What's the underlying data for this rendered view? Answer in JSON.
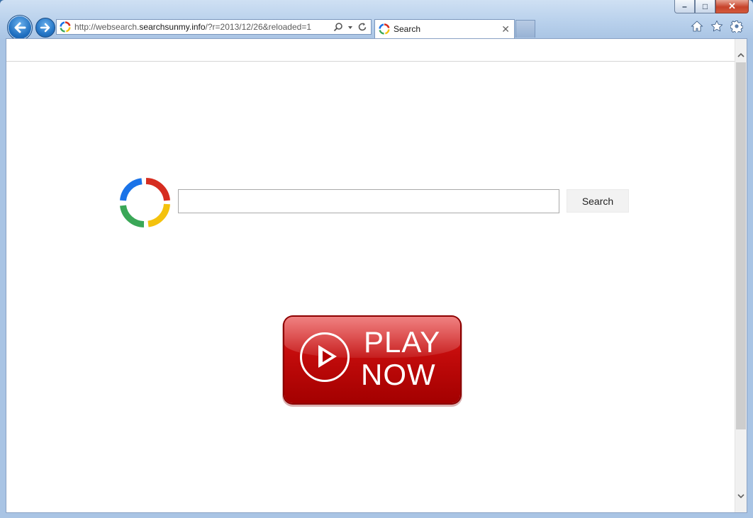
{
  "window": {
    "minimize_label": "–",
    "maximize_label": "□",
    "close_label": "✕"
  },
  "address_bar": {
    "url_prefix": "http://websearch.",
    "url_domain": "searchsunmy.info",
    "url_path": "/?r=2013/12/26&reloaded=1"
  },
  "tab": {
    "title": "Search",
    "close_label": "✕"
  },
  "toolbar_icons": [
    "home-icon",
    "favorites-star-icon",
    "gear-icon"
  ],
  "page": {
    "search_value": "",
    "search_button_label": "Search",
    "play_line1": "PLAY",
    "play_line2": "NOW"
  },
  "colors": {
    "accent": "#1f6fc0",
    "play_red": "#c20b0b",
    "logo_red": "#d62d20",
    "logo_yellow": "#f4c20d",
    "logo_green": "#3aa757",
    "logo_blue": "#1a73e8"
  }
}
